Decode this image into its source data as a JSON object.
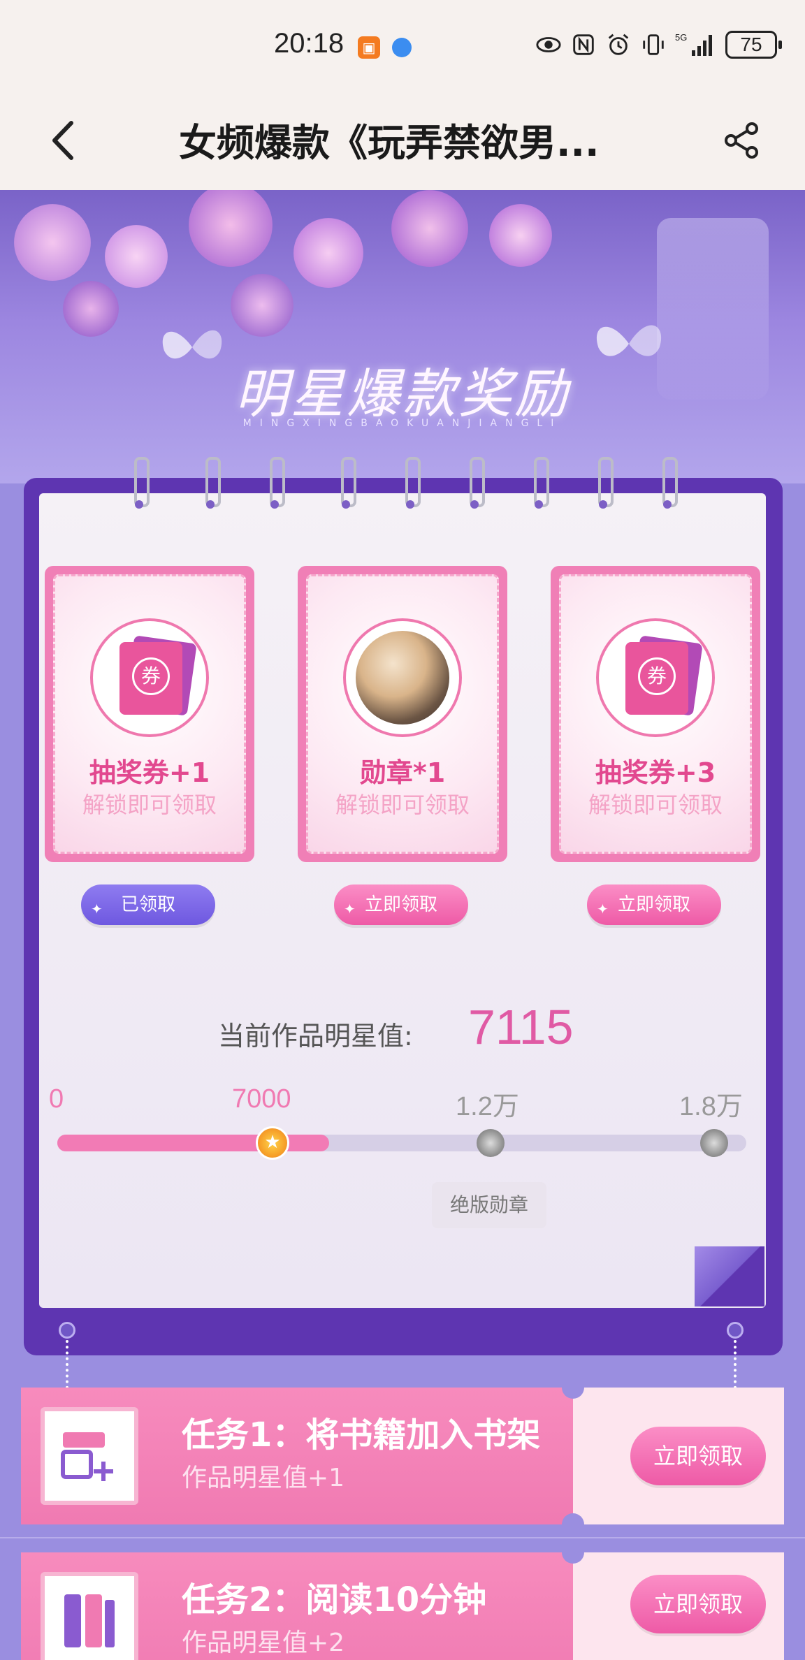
{
  "status_bar": {
    "time": "20:18",
    "network": "5G",
    "battery": "75"
  },
  "nav": {
    "title": "女频爆款《玩弄禁欲男..."
  },
  "banner": {
    "title": "明星爆款奖励",
    "pinyin": "MINGXINGBAOKUANJIANGLI"
  },
  "rewards": [
    {
      "name": "抽奖券+1",
      "sub": "解锁即可领取",
      "button": "已领取",
      "state": "claimed",
      "icon": "ticket-icon",
      "ticket_char": "券"
    },
    {
      "name": "勋章*1",
      "sub": "解锁即可领取",
      "button": "立即领取",
      "state": "claimable",
      "icon": "medal-icon"
    },
    {
      "name": "抽奖券+3",
      "sub": "解锁即可领取",
      "button": "立即领取",
      "state": "claimable",
      "icon": "ticket-icon",
      "ticket_char": "券"
    }
  ],
  "score": {
    "label": "当前作品明星值:",
    "value": "7115",
    "progress_fraction": 0.395,
    "ticks": [
      "0",
      "7000",
      "1.2万",
      "1.8万"
    ],
    "milestone_label": "绝版勋章"
  },
  "tasks": [
    {
      "title": "任务1：将书籍加入书架",
      "sub": "作品明星值+1",
      "button": "立即领取",
      "icon": "bookshelf-add-icon"
    },
    {
      "title": "任务2：阅读10分钟",
      "sub": "作品明星值+2",
      "button": "立即领取",
      "icon": "book-icon"
    }
  ],
  "colors": {
    "accent_pink": "#e2488f",
    "button_pink": "#ee5aa6",
    "purple_frame": "#5e35b1",
    "claimed_purple": "#6e58e0"
  }
}
